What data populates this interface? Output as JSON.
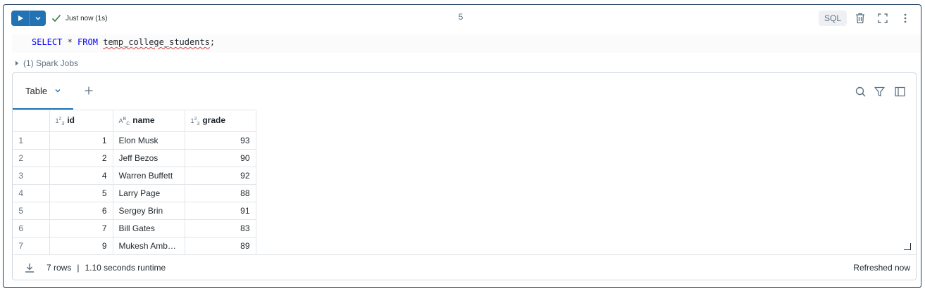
{
  "toolbar": {
    "status_text": "Just now (1s)",
    "cell_index": "5",
    "language_badge": "SQL"
  },
  "code": {
    "kw_select": "SELECT",
    "star": " * ",
    "kw_from": "FROM",
    "space": " ",
    "table_name": "temp_college_students",
    "semicolon": ";"
  },
  "spark_jobs": {
    "label": "(1) Spark Jobs"
  },
  "results": {
    "tab_label": "Table",
    "columns": [
      {
        "name": "id",
        "type_icon": "integer-type-icon"
      },
      {
        "name": "name",
        "type_icon": "string-type-icon"
      },
      {
        "name": "grade",
        "type_icon": "integer-type-icon"
      }
    ],
    "rows": [
      {
        "row": "1",
        "id": "1",
        "name": "Elon Musk",
        "grade": "93"
      },
      {
        "row": "2",
        "id": "2",
        "name": "Jeff Bezos",
        "grade": "90"
      },
      {
        "row": "3",
        "id": "4",
        "name": "Warren Buffett",
        "grade": "92"
      },
      {
        "row": "4",
        "id": "5",
        "name": "Larry Page",
        "grade": "88"
      },
      {
        "row": "5",
        "id": "6",
        "name": "Sergey Brin",
        "grade": "91"
      },
      {
        "row": "6",
        "id": "7",
        "name": "Bill Gates",
        "grade": "83"
      },
      {
        "row": "7",
        "id": "9",
        "name": "Mukesh Amb…",
        "grade": "89"
      }
    ],
    "footer": {
      "row_count": "7 rows",
      "separator": "|",
      "runtime": "1.10 seconds runtime",
      "refreshed": "Refreshed now"
    }
  },
  "colors": {
    "accent": "#2272b4",
    "success": "#277c43",
    "cell_border": "#1d3d5c",
    "keyword": "#0000ff"
  }
}
